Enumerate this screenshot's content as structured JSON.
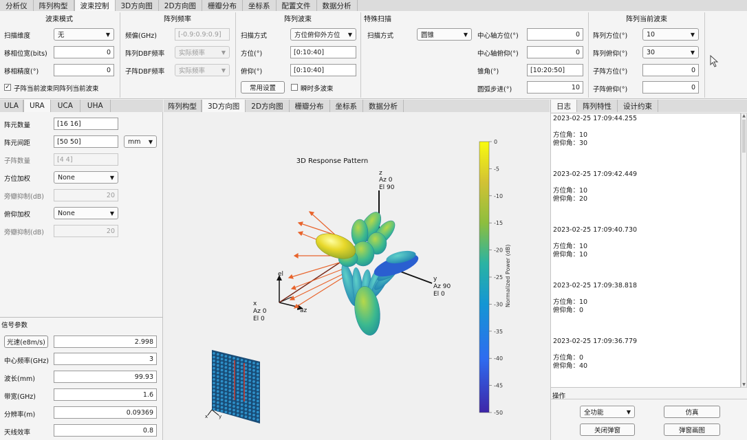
{
  "top_tabs": [
    "分析仪",
    "阵列构型",
    "波束控制",
    "3D方向图",
    "2D方向图",
    "栅瓣分布",
    "坐标系",
    "配置文件",
    "数据分析"
  ],
  "sec_beam_mode": {
    "title": "波束模式",
    "scan_dim_label": "扫描维度",
    "scan_dim_value": "无",
    "shift_bits_label": "移相位宽(bits)",
    "shift_bits_value": "0",
    "shift_prec_label": "移相精度(°)",
    "shift_prec_value": "0",
    "sync_label": "子阵当前波束同阵列当前波束"
  },
  "sec_freq": {
    "title": "阵列频率",
    "offset_label": "频偏(GHz)",
    "offset_value": "[-0.9:0.9:0.9]",
    "dbf_label": "阵列DBF频率",
    "dbf_value": "实际频率",
    "sub_dbf_label": "子阵DBF频率",
    "sub_dbf_value": "实际频率"
  },
  "sec_array_beam": {
    "title": "阵列波束",
    "scan_mode_label": "扫描方式",
    "scan_mode_value": "方位俯仰外方位",
    "az_label": "方位(°)",
    "az_value": "[0:10:40]",
    "el_label": "俯仰(°)",
    "el_value": "[0:10:40]",
    "common_btn": "常用设置",
    "multi_label": "瞬时多波束"
  },
  "sec_special": {
    "title": "特殊扫描",
    "scan_mode_label": "扫描方式",
    "scan_mode_value": "圆锥",
    "center_az_label": "中心轴方位(°)",
    "center_az_value": "0",
    "center_el_label": "中心轴俯仰(°)",
    "center_el_value": "0",
    "cone_label": "锥角(°)",
    "cone_value": "[10:20:50]",
    "arc_label": "圆弧步进(°)",
    "arc_value": "10"
  },
  "sec_current": {
    "title": "阵列当前波束",
    "az_label": "阵列方位(°)",
    "az_value": "10",
    "el_label": "阵列俯仰(°)",
    "el_value": "30",
    "sub_az_label": "子阵方位(°)",
    "sub_az_value": "0",
    "sub_el_label": "子阵俯仰(°)",
    "sub_el_value": "0"
  },
  "left_tabs": [
    "ULA",
    "URA",
    "UCA",
    "UHA"
  ],
  "ura": {
    "count_label": "阵元数量",
    "count_value": "[16 16]",
    "spacing_label": "阵元间距",
    "spacing_value": "[50 50]",
    "spacing_unit": "mm",
    "sub_label": "子阵数量",
    "sub_value": "[4 4]",
    "az_w_label": "方位加权",
    "az_w_value": "None",
    "az_sl_label": "旁瓣抑制(dB)",
    "az_sl_value": "20",
    "el_w_label": "俯仰加权",
    "el_w_value": "None",
    "el_sl_label": "旁瓣抑制(dB)",
    "el_sl_value": "20"
  },
  "signal": {
    "title": "信号参数",
    "c_btn": "光速(e8m/s)",
    "c_value": "2.998",
    "fc_label": "中心频率(GHz)",
    "fc_value": "3",
    "wl_label": "波长(mm)",
    "wl_value": "99.93",
    "bw_label": "带宽(GHz)",
    "bw_value": "1.6",
    "res_label": "分辨率(m)",
    "res_value": "0.09369",
    "eff_label": "天线效率",
    "eff_value": "0.8"
  },
  "center_tabs": [
    "阵列构型",
    "3D方向图",
    "2D方向图",
    "栅瓣分布",
    "坐标系",
    "数据分析"
  ],
  "plot": {
    "title": "3D Response Pattern",
    "z_label": "z",
    "z_az": "Az 0",
    "z_el": "El 90",
    "y_label": "y",
    "y_az": "Az 90",
    "y_el": "El 0",
    "x_label": "x",
    "x_az": "Az 0",
    "x_el": "El 0",
    "el_label": "el",
    "az_label": "az",
    "colorbar_label": "Normalized Power (dB)",
    "colorbar_ticks": [
      "0",
      "-5",
      "-10",
      "-15",
      "-20",
      "-25",
      "-30",
      "-35",
      "-40",
      "-45",
      "-50"
    ],
    "array_x": "x",
    "array_y": "y"
  },
  "right_tabs": [
    "日志",
    "阵列特性",
    "设计约束"
  ],
  "log": [
    {
      "time": "2023-02-25 17:09:44.255",
      "az": "方位角：10",
      "el": "俯仰角：30"
    },
    {
      "time": "2023-02-25 17:09:42.449",
      "az": "方位角：10",
      "el": "俯仰角：20"
    },
    {
      "time": "2023-02-25 17:09:40.730",
      "az": "方位角：10",
      "el": "俯仰角：10"
    },
    {
      "time": "2023-02-25 17:09:38.818",
      "az": "方位角：10",
      "el": "俯仰角：0"
    },
    {
      "time": "2023-02-25 17:09:36.779",
      "az": "方位角：0",
      "el": "俯仰角：40"
    }
  ],
  "ops": {
    "title": "操作",
    "mode_value": "全功能",
    "sim_btn": "仿真",
    "close_btn": "关闭弹窗",
    "popup_btn": "弹窗画图"
  }
}
